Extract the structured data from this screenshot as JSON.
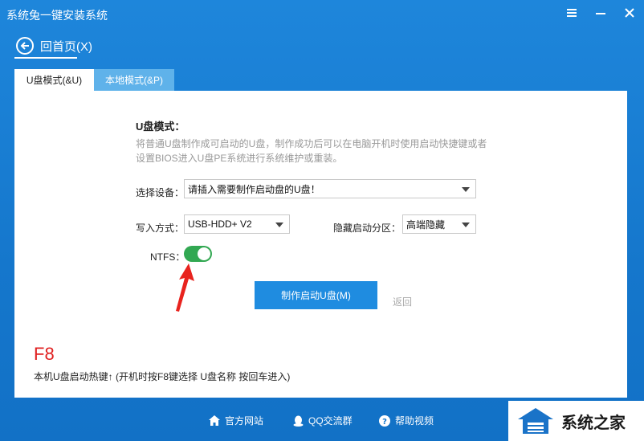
{
  "window": {
    "title": "系统兔一键安装系统",
    "controls": [
      "menu-icon",
      "minimize-icon",
      "close-icon"
    ]
  },
  "back": {
    "label": "回首页(X)"
  },
  "tabs": [
    {
      "label": "U盘模式(&U)",
      "active": true
    },
    {
      "label": "本地模式(&P)",
      "active": false
    }
  ],
  "usb_mode": {
    "title": "U盘模式：",
    "description": "将普通U盘制作成可启动的U盘，制作成功后可以在电脑开机时使用启动快捷键或者设置BIOS进入U盘PE系统进行系统维护或重装。",
    "device_label": "选择设备：",
    "device_value": "请插入需要制作启动盘的U盘！",
    "write_label": "写入方式：",
    "write_value": "USB-HDD+ V2",
    "hidden_label": "隐藏启动分区：",
    "hidden_value": "高端隐藏",
    "ntfs_label": "NTFS：",
    "ntfs_on": true,
    "make_button": "制作启动U盘(M)",
    "return_link": "返回"
  },
  "hotkey": {
    "key": "F8",
    "text": "本机U盘启动热键↑ (开机时按F8键选择 U盘名称 按回车进入)"
  },
  "footer": {
    "links": [
      {
        "label": "官方网站",
        "icon": "home-icon"
      },
      {
        "label": "QQ交流群",
        "icon": "qq-icon"
      },
      {
        "label": "帮助视频",
        "icon": "help-icon"
      }
    ]
  },
  "watermark": {
    "text": "系统之家"
  },
  "colors": {
    "titlebar_blue": "#1e86db",
    "tab_inactive": "#5fb2ea",
    "button_blue": "#1f8ce0",
    "toggle_green": "#32a852",
    "hotkey_red": "#e02020"
  }
}
